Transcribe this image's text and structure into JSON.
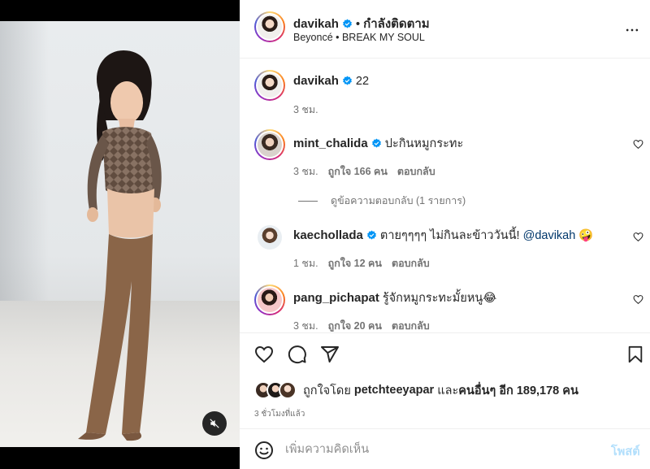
{
  "post": {
    "username": "davikah",
    "follow_status": "กำลังติดตาม",
    "audio": "Beyoncé • BREAK MY SOUL",
    "caption_text": "22",
    "caption_time": "3 ชม."
  },
  "comments": [
    {
      "username": "mint_chalida",
      "text": "ปะกินหมูกระทะ",
      "time": "3 ชม.",
      "likes": "ถูกใจ 166 คน",
      "reply": "ตอบกลับ",
      "view_replies": "ดูข้อความตอบกลับ (1 รายการ)"
    },
    {
      "username": "kaechollada",
      "text": "ตายๆๆๆๆ ไม่กินละข้าววันนี้!",
      "mention": "@davikah",
      "emoji": "🤪",
      "time": "1 ชม.",
      "likes": "ถูกใจ 12 คน",
      "reply": "ตอบกลับ"
    },
    {
      "username": "pang_pichapat",
      "text": "รู้จักหมูกระทะมั้ยหนู😂",
      "time": "3 ชม.",
      "likes": "ถูกใจ 20 คน",
      "reply": "ตอบกลับ"
    }
  ],
  "likes_summary": {
    "prefix": "ถูกใจโดย",
    "user": "petchteeyapar",
    "joiner": "และ",
    "others": "คนอื่นๆ อีก 189,178 คน"
  },
  "time_ago": "3 ชั่วโมงที่แล้ว",
  "composer": {
    "placeholder": "เพิ่มความคิดเห็น",
    "post_label": "โพสต์"
  },
  "icons": {
    "verified": "verified-badge-icon",
    "more": "more-options-icon",
    "like": "heart-icon",
    "comment": "comment-icon",
    "share": "share-icon",
    "save": "bookmark-icon",
    "mute": "mute-icon",
    "emoji": "emoji-icon"
  },
  "colors": {
    "verified": "#0095f6",
    "post_button": "#b2dffc",
    "mention": "#00376b",
    "meta": "#737373"
  }
}
